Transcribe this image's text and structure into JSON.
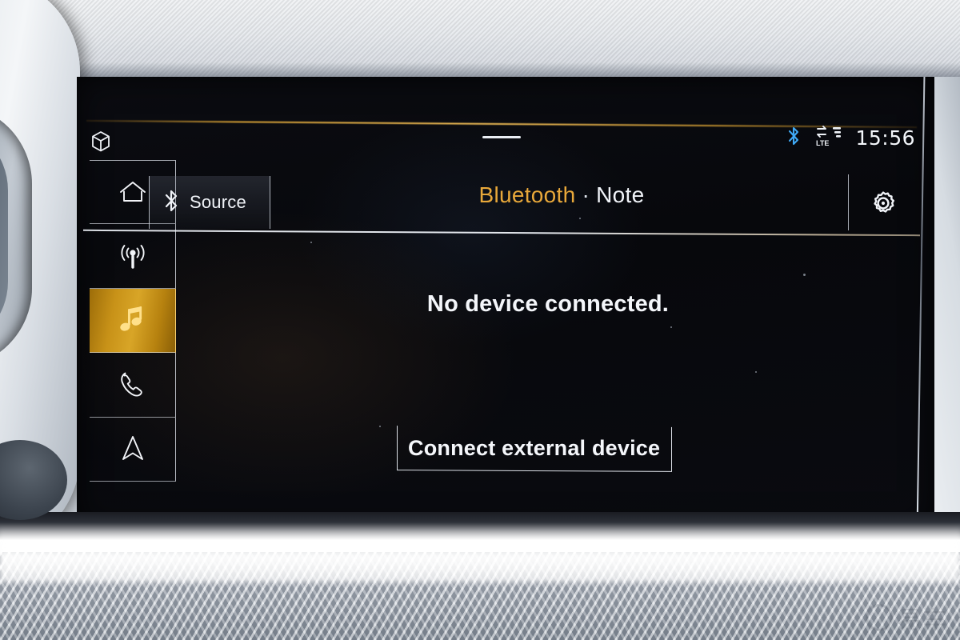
{
  "device": {
    "kind": "car-infotainment-touchscreen",
    "scene": "vehicle-dashboard"
  },
  "statusbar": {
    "apps_icon": "cube-icon",
    "pull_handle": "drag-handle",
    "bluetooth_icon": "bluetooth-icon",
    "network_icon": "lte-signal-icon",
    "network_label": "LTE",
    "clock": "15:56"
  },
  "sidebar": {
    "items": [
      {
        "id": "home",
        "icon": "home-icon",
        "label": "Home",
        "active": false
      },
      {
        "id": "radio",
        "icon": "radio-tower-icon",
        "label": "Radio",
        "active": false
      },
      {
        "id": "media",
        "icon": "music-note-icon",
        "label": "Media",
        "active": true
      },
      {
        "id": "phone",
        "icon": "phone-icon",
        "label": "Phone",
        "active": false
      },
      {
        "id": "navigation",
        "icon": "navigation-arrow-icon",
        "label": "Navigation",
        "active": false
      }
    ]
  },
  "header": {
    "source_icon": "bluetooth-icon",
    "source_label": "Source",
    "title_primary": "Bluetooth",
    "title_separator": "·",
    "title_secondary": "Note",
    "settings_icon": "gear-icon"
  },
  "content": {
    "status_message": "No device connected.",
    "connect_button_label": "Connect external device"
  },
  "watermark": {
    "text": "易车"
  },
  "colors": {
    "accent_amber": "#e8a83a",
    "active_tile_gold": "#c89218",
    "text_primary": "#f4f6fa",
    "bluetooth_blue": "#3fa9f5",
    "screen_black": "#07080c"
  }
}
